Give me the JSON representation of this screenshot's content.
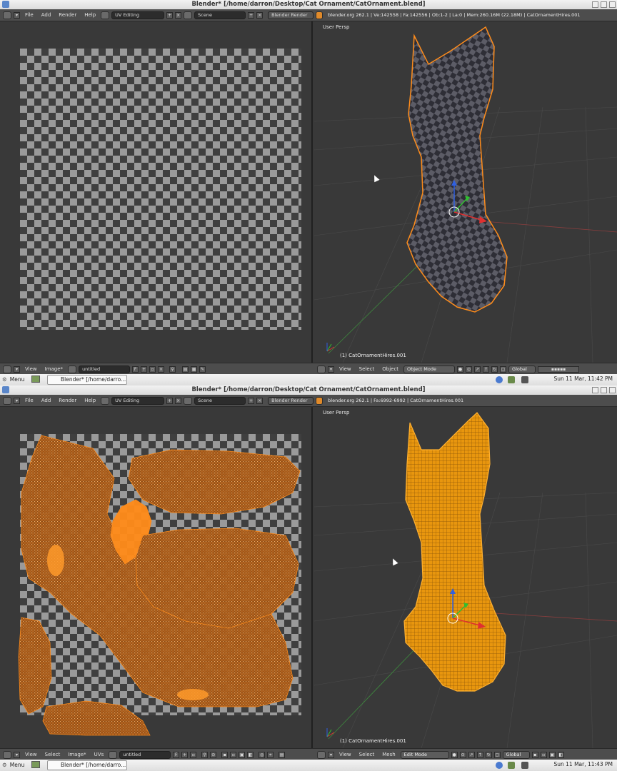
{
  "windows": [
    {
      "title": "Blender* [/home/darron/Desktop/Cat Ornament/CatOrnament.blend]",
      "menus": [
        "File",
        "Add",
        "Render",
        "Help"
      ],
      "layout": "UV Editing",
      "scene": "Scene",
      "engine": "Blender Render",
      "info": "blender.org 262.1 | Ve:142558 | Fa:142556 | Ob:1-2 | La:0 | Mem:260.16M (22.18M) | CatOrnamentHires.001",
      "viewport_label": "User Persp",
      "object_label": "(1) CatOrnamentHires.001",
      "uv_footer": [
        "View",
        "Image*"
      ],
      "image_name": "untitled",
      "image_flag": "F",
      "vp_footer": [
        "View",
        "Select",
        "Object"
      ],
      "mode": "Object Mode",
      "orientation": "Global",
      "clock": "Sun 11 Mar, 11:42 PM",
      "cat_style": "textured",
      "islands": false
    },
    {
      "title": "Blender* [/home/darron/Desktop/Cat Ornament/CatOrnament.blend]",
      "menus": [
        "File",
        "Add",
        "Render",
        "Help"
      ],
      "layout": "UV Editing",
      "scene": "Scene",
      "engine": "Blender Render",
      "info": "blender.org 262.1 | Fa:6992-6992 | CatOrnamentHires.001",
      "viewport_label": "User Persp",
      "object_label": "(1) CatOrnamentHires.001",
      "uv_footer": [
        "View",
        "Select",
        "Image*",
        "UVs"
      ],
      "image_name": "untitled",
      "image_flag": "F",
      "vp_footer": [
        "View",
        "Select",
        "Mesh"
      ],
      "mode": "Edit Mode",
      "orientation": "Global",
      "clock": "Sun 11 Mar, 11:43 PM",
      "cat_style": "wireframe",
      "islands": true
    }
  ],
  "taskbar": {
    "menu_label": "Menu",
    "task_label": "Blender* [/home/darro..."
  },
  "colors": {
    "select": "#ff8c1a",
    "uv_fill": "#c06a1e",
    "axis_x": "#e03030",
    "axis_y": "#30c030",
    "axis_z": "#3060e0"
  }
}
